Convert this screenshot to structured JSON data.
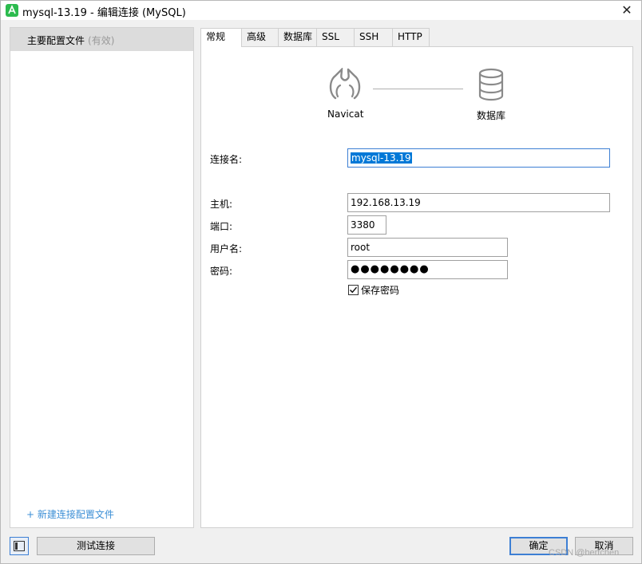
{
  "window": {
    "title": "mysql-13.19 - 编辑连接 (MySQL)",
    "close_glyph": "✕",
    "app_color": "#2cbb4e"
  },
  "sidebar": {
    "profile_label": "主要配置文件",
    "profile_status": "(有效)",
    "new_profile_link": "+ 新建连接配置文件"
  },
  "tabs": [
    {
      "label": "常规",
      "active": true
    },
    {
      "label": "高级",
      "active": false
    },
    {
      "label": "数据库",
      "active": false
    },
    {
      "label": "SSL",
      "active": false
    },
    {
      "label": "SSH",
      "active": false
    },
    {
      "label": "HTTP",
      "active": false
    }
  ],
  "diagram": {
    "left_label": "Navicat",
    "right_label": "数据库",
    "left_icon": "navicat-logo-icon",
    "right_icon": "database-icon"
  },
  "form": {
    "connection_name_label": "连接名:",
    "connection_name_value": "mysql-13.19",
    "host_label": "主机:",
    "host_value": "192.168.13.19",
    "port_label": "端口:",
    "port_value": "3380",
    "username_label": "用户名:",
    "username_value": "root",
    "password_label": "密码:",
    "password_value": "●●●●●●●●",
    "save_password_label": "保存密码",
    "save_password_checked": true
  },
  "footer": {
    "test_button": "测试连接",
    "ok_button": "确定",
    "cancel_button": "取消",
    "watermark": "CSDN @bertchen",
    "accent_color": "#3d7fd4"
  }
}
